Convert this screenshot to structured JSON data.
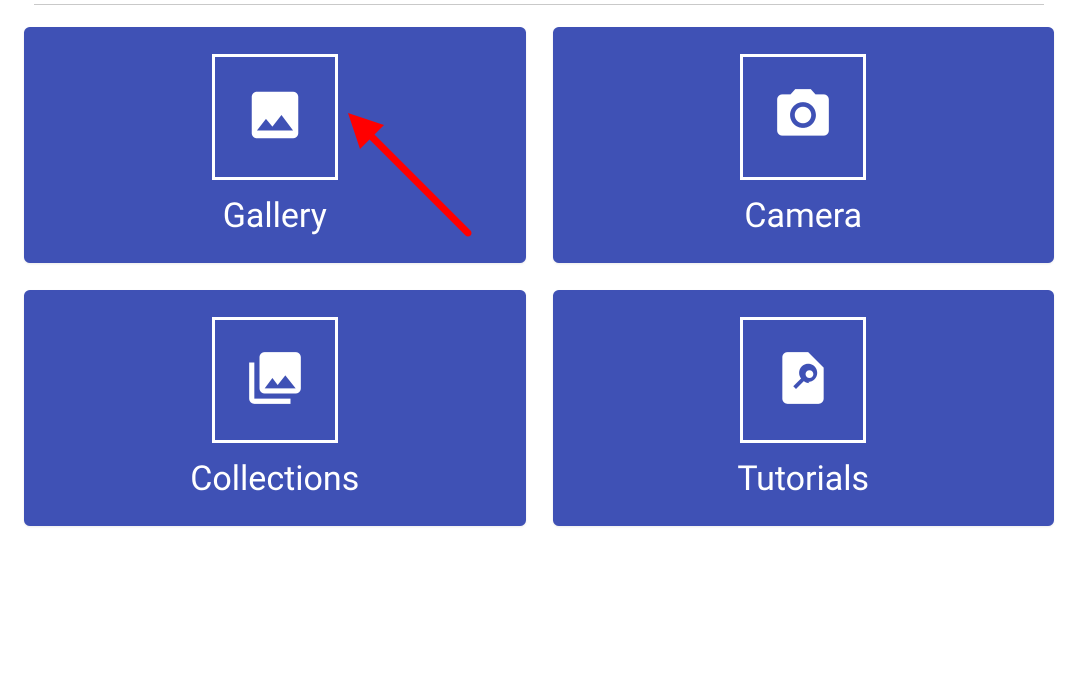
{
  "cards": [
    {
      "label": "Gallery",
      "icon": "image-icon"
    },
    {
      "label": "Camera",
      "icon": "camera-icon"
    },
    {
      "label": "Collections",
      "icon": "collections-icon"
    },
    {
      "label": "Tutorials",
      "icon": "search-page-icon"
    }
  ],
  "colors": {
    "card_bg": "#3f51b5",
    "card_fg": "#ffffff",
    "arrow": "#ff0000"
  },
  "annotation": {
    "type": "arrow",
    "target": "gallery-card"
  }
}
